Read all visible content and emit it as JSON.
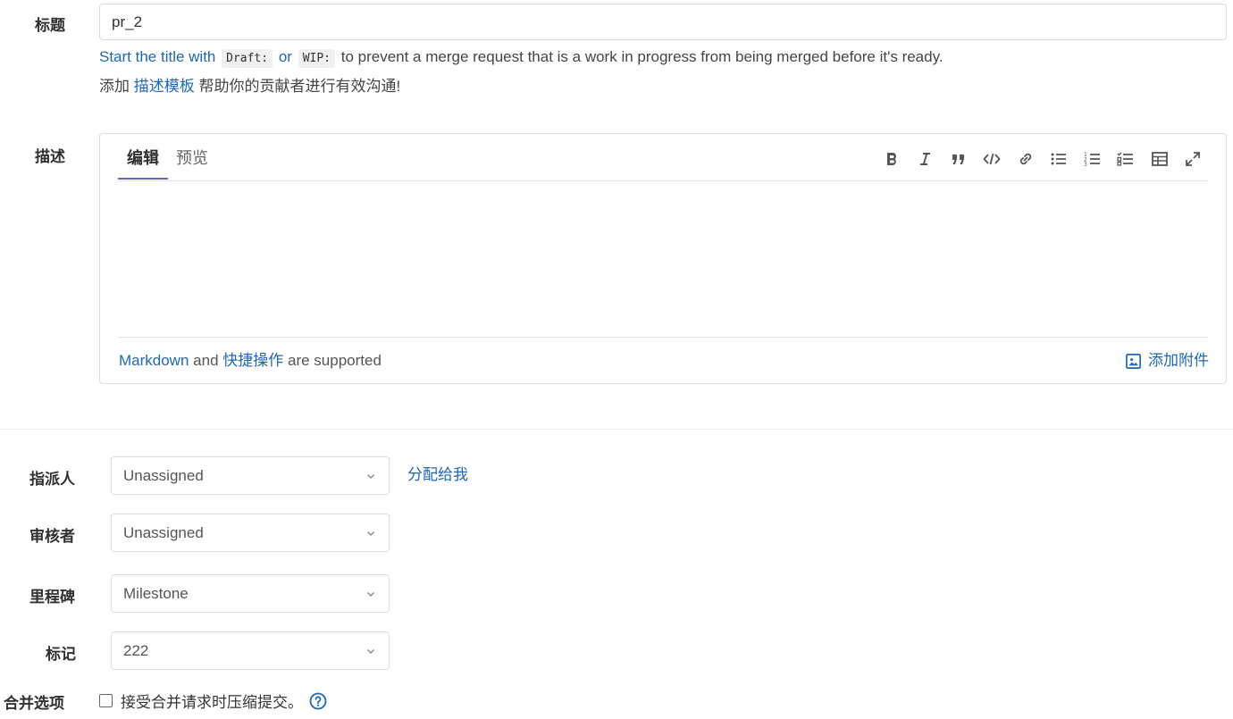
{
  "title_field": {
    "label": "标题",
    "value": "pr_2"
  },
  "draft_hint": {
    "link_text": "Start the title with",
    "code1": "Draft:",
    "or_text": "or",
    "code2": "WIP:",
    "suffix": "to prevent a merge request that is a work in progress from being merged before it's ready."
  },
  "template_hint": {
    "prefix": "添加",
    "link_text": "描述模板",
    "suffix": "帮助你的贡献者进行有效沟通!"
  },
  "description": {
    "label": "描述",
    "tab_edit": "编辑",
    "tab_preview": "预览",
    "toolbar_icons": [
      "bold-icon",
      "italic-icon",
      "quote-icon",
      "code-icon",
      "link-icon",
      "bullet-list-icon",
      "numbered-list-icon",
      "task-list-icon",
      "table-icon",
      "fullscreen-icon"
    ],
    "markdown_link": "Markdown",
    "and_text": "and",
    "quick_actions_link": "快捷操作",
    "supported_text": "are supported",
    "attach_label": "添加附件"
  },
  "assignee": {
    "label": "指派人",
    "value": "Unassigned",
    "assign_me": "分配给我"
  },
  "reviewer": {
    "label": "审核者",
    "value": "Unassigned"
  },
  "milestone": {
    "label": "里程碑",
    "value": "Milestone"
  },
  "labels": {
    "label": "标记",
    "value": "222"
  },
  "merge_options": {
    "label": "合并选项",
    "squash_text": "接受合并请求时压缩提交。",
    "squash_checked": false
  },
  "colors": {
    "link": "#1f67b1",
    "active_tab": "#6666c4"
  }
}
